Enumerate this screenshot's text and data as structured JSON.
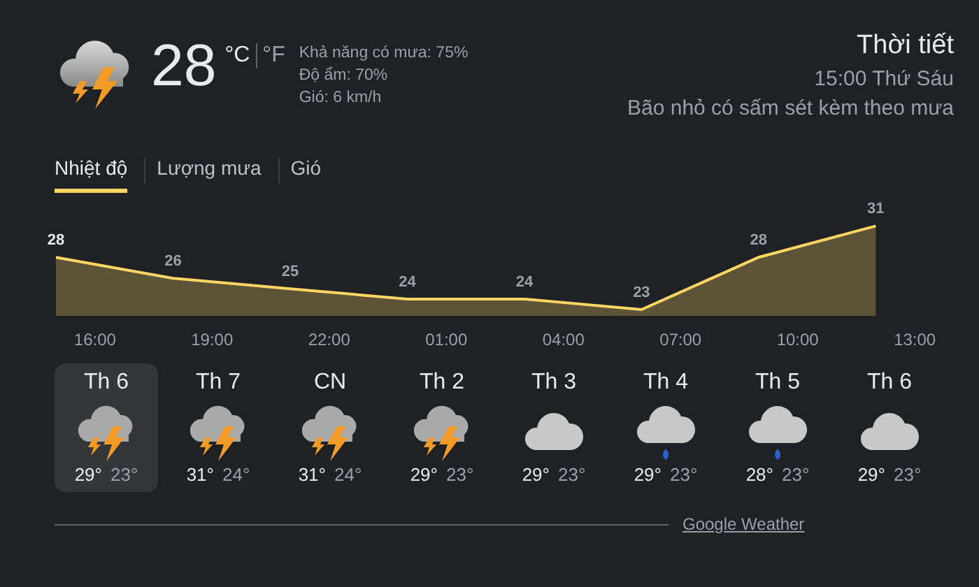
{
  "current": {
    "temperature": "28",
    "units": [
      {
        "label": "°C",
        "selected": true
      },
      {
        "label": "°F",
        "selected": false
      }
    ],
    "details": [
      "Khả năng có mưa: 75%",
      "Độ ẩm: 70%",
      "Gió: 6 km/h"
    ]
  },
  "header": {
    "title": "Thời tiết",
    "time": "15:00 Thứ Sáu",
    "condition": "Bão nhỏ có sấm sét kèm theo mưa"
  },
  "tabs": [
    {
      "label": "Nhiệt độ",
      "selected": true
    },
    {
      "label": "Lượng mưa",
      "selected": false
    },
    {
      "label": "Gió",
      "selected": false
    }
  ],
  "chart_data": {
    "type": "area",
    "categories": [
      null,
      "16:00",
      null,
      null,
      "19:00",
      null,
      null,
      "22:00",
      null,
      null,
      "01:00",
      null,
      null,
      "04:00",
      null,
      null,
      "07:00",
      null,
      null,
      "10:00",
      null,
      null,
      "13:00",
      null
    ],
    "series": [
      {
        "color": "#fdd663",
        "values": [
          28,
          null,
          null,
          26,
          null,
          null,
          25,
          null,
          null,
          24,
          null,
          null,
          24,
          null,
          null,
          23,
          null,
          null,
          28,
          null,
          null,
          31,
          null,
          null
        ]
      }
    ],
    "data_labels": true
  },
  "days": [
    {
      "label": "Th 6",
      "kind": "storm",
      "high": "29°",
      "low": "23°",
      "selected": true
    },
    {
      "label": "Th 7",
      "kind": "storm",
      "high": "31°",
      "low": "24°",
      "selected": false
    },
    {
      "label": "CN",
      "kind": "storm",
      "high": "31°",
      "low": "24°",
      "selected": false
    },
    {
      "label": "Th 2",
      "kind": "storm",
      "high": "29°",
      "low": "23°",
      "selected": false
    },
    {
      "label": "Th 3",
      "kind": "cloud",
      "high": "29°",
      "low": "23°",
      "selected": false
    },
    {
      "label": "Th 4",
      "kind": "rain",
      "high": "29°",
      "low": "23°",
      "selected": false
    },
    {
      "label": "Th 5",
      "kind": "rain",
      "high": "28°",
      "low": "23°",
      "selected": false
    },
    {
      "label": "Th 6",
      "kind": "cloud",
      "high": "29°",
      "low": "23°",
      "selected": false
    }
  ],
  "source": "Google Weather"
}
